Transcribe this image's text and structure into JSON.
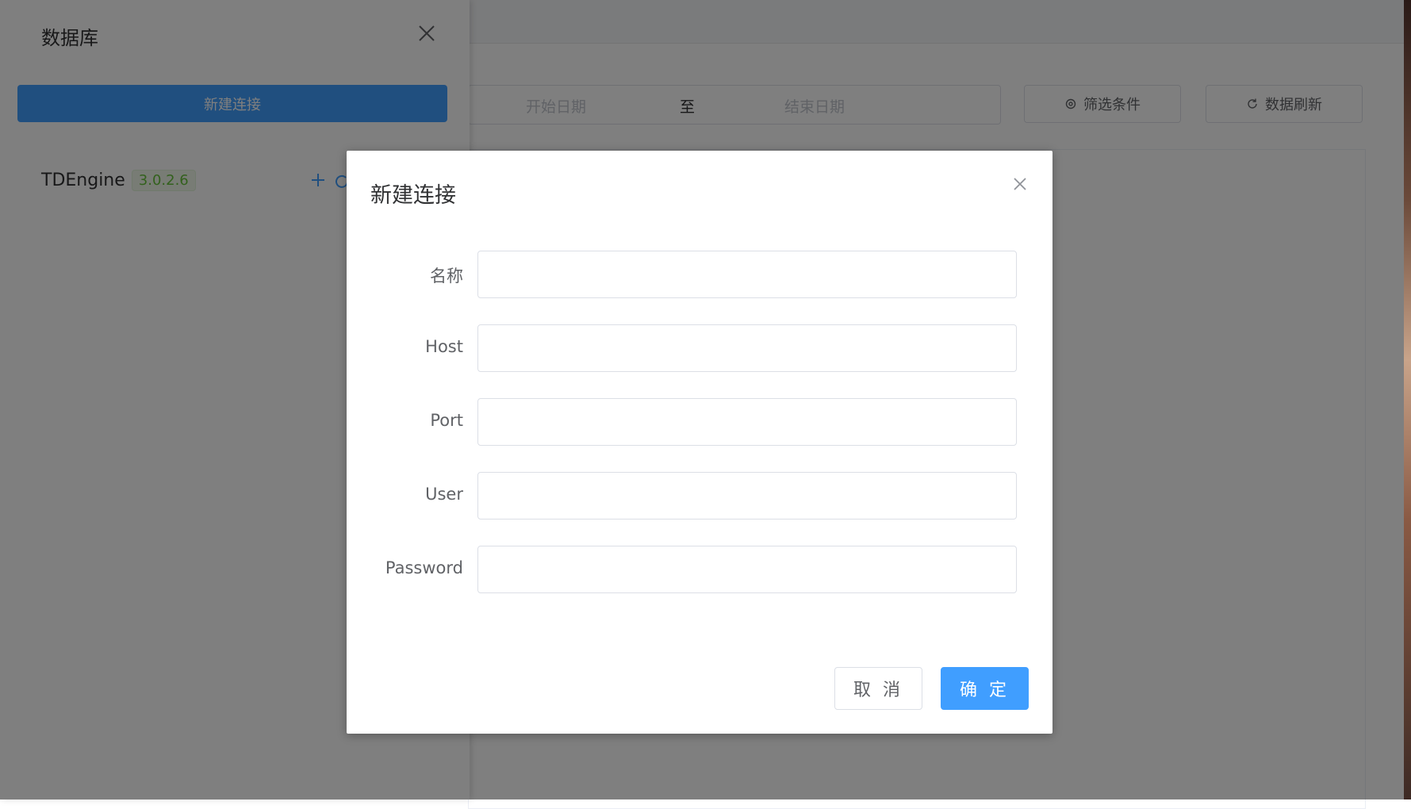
{
  "toolbar": {
    "start_date_placeholder": "开始日期",
    "range_separator": "至",
    "end_date_placeholder": "结束日期",
    "filter_label": "筛选条件",
    "refresh_label": "数据刷新"
  },
  "drawer": {
    "title": "数据库",
    "new_connection_label": "新建连接",
    "connections": [
      {
        "name": "TDEngine",
        "version": "3.0.2.6"
      }
    ]
  },
  "modal": {
    "title": "新建连接",
    "fields": {
      "name": {
        "label": "名称",
        "value": ""
      },
      "host": {
        "label": "Host",
        "value": ""
      },
      "port": {
        "label": "Port",
        "value": ""
      },
      "user": {
        "label": "User",
        "value": ""
      },
      "password": {
        "label": "Password",
        "value": ""
      }
    },
    "cancel_label": "取 消",
    "confirm_label": "确 定"
  },
  "colors": {
    "primary": "#409eff",
    "version_tag_text": "#67c23a",
    "overlay": "rgba(0,0,0,0.5)"
  },
  "icons": {
    "drawer_close": "close-icon",
    "filter": "gear-icon",
    "refresh": "refresh-icon",
    "add": "plus-icon",
    "modal_close": "close-icon"
  }
}
